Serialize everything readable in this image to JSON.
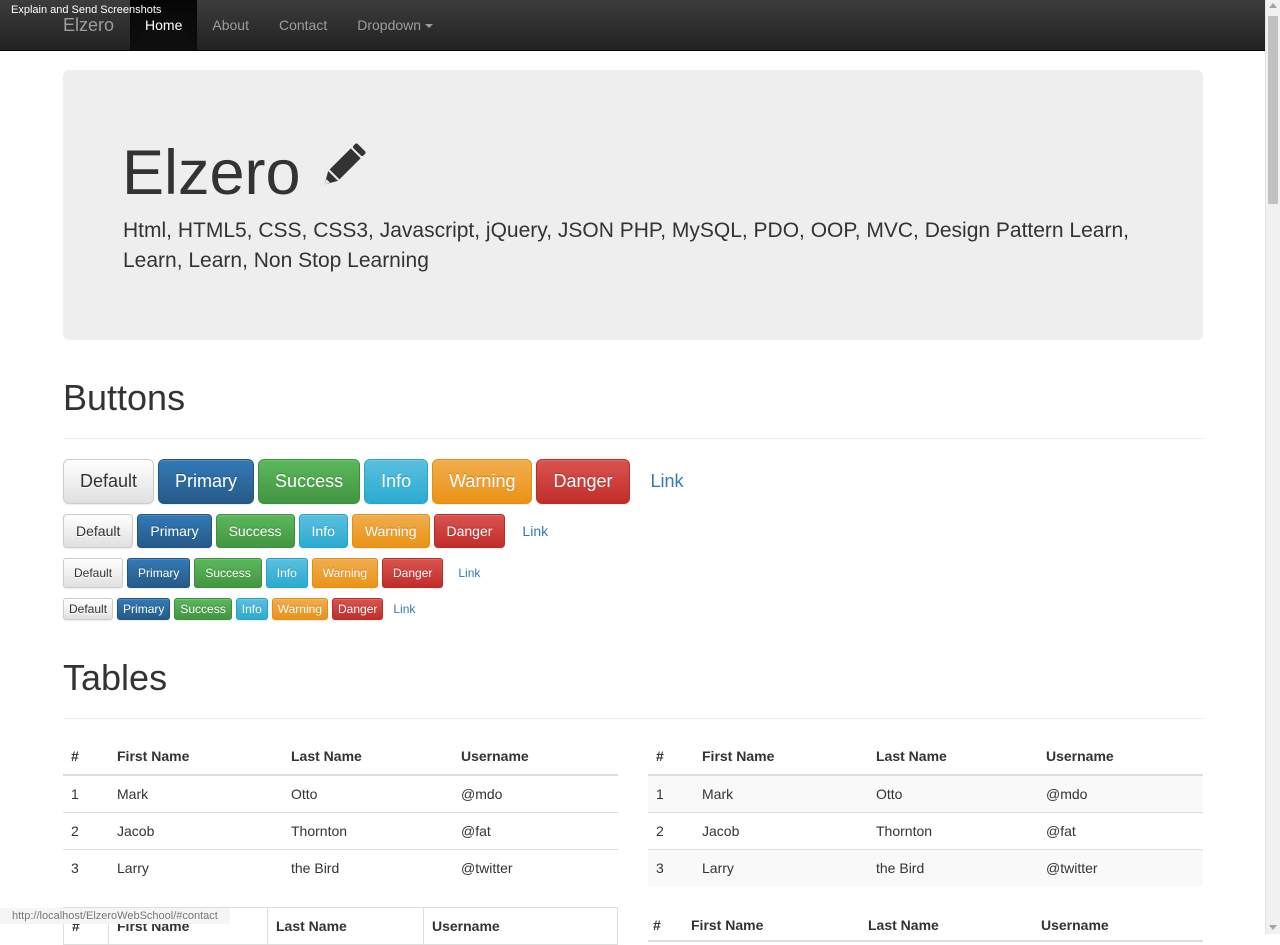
{
  "overlay": {
    "label": "Explain and Send Screenshots"
  },
  "navbar": {
    "brand": "Elzero",
    "items": [
      "Home",
      "About",
      "Contact",
      "Dropdown"
    ]
  },
  "jumbotron": {
    "title": "Elzero",
    "text": "Html, HTML5, CSS, CSS3, Javascript, jQuery, JSON PHP, MySQL, PDO, OOP, MVC, Design Pattern Learn, Learn, Learn, Non Stop Learning"
  },
  "buttons": {
    "heading": "Buttons",
    "labels": [
      "Default",
      "Primary",
      "Success",
      "Info",
      "Warning",
      "Danger",
      "Link"
    ]
  },
  "tables": {
    "heading": "Tables",
    "columns": [
      "#",
      "First Name",
      "Last Name",
      "Username"
    ],
    "rows": [
      [
        "1",
        "Mark",
        "Otto",
        "@mdo"
      ],
      [
        "2",
        "Jacob",
        "Thornton",
        "@fat"
      ],
      [
        "3",
        "Larry",
        "the Bird",
        "@twitter"
      ]
    ]
  },
  "status": {
    "url": "http://localhost/ElzeroWebSchool/#contact"
  }
}
